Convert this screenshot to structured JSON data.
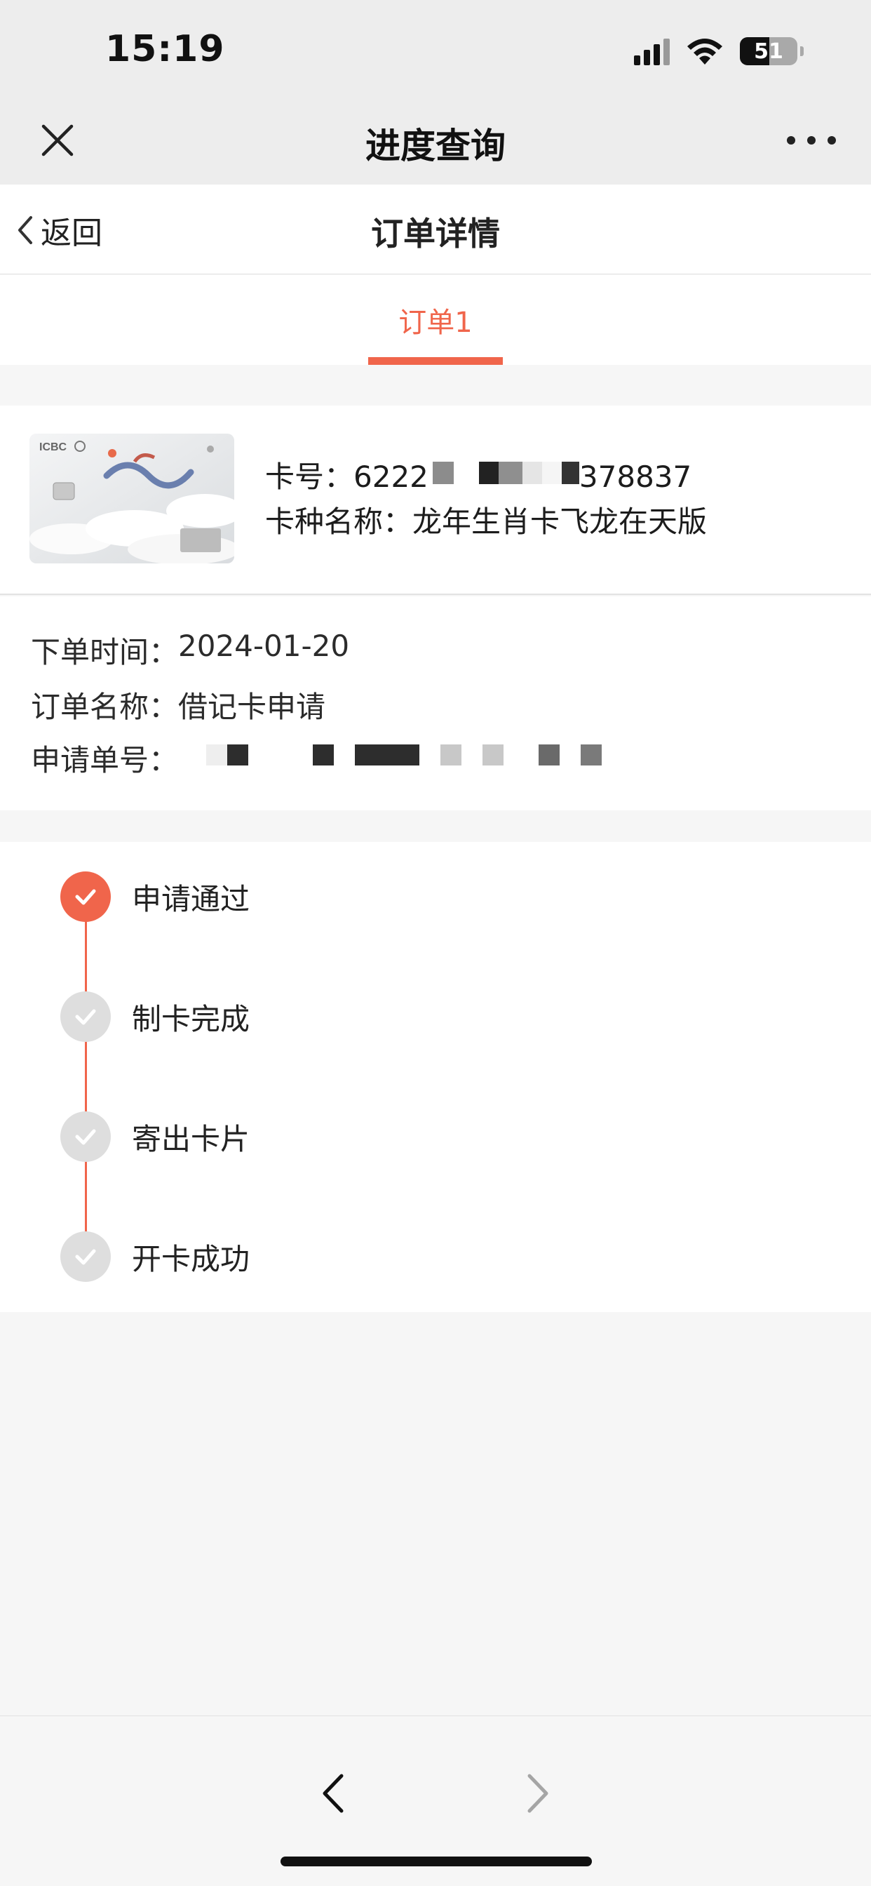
{
  "status_bar": {
    "time": "15:19",
    "battery": "51"
  },
  "wechat_bar": {
    "title": "进度查询",
    "close_icon": "close-icon",
    "more_icon": "more-icon"
  },
  "header": {
    "back_label": "返回",
    "title": "订单详情"
  },
  "tabs": [
    {
      "label": "订单1",
      "active": true
    }
  ],
  "card": {
    "number_label": "卡号：",
    "number_prefix": "6222",
    "number_suffix": "378837",
    "type_label": "卡种名称：",
    "type_value": "龙年生肖卡飞龙在天版"
  },
  "order": {
    "time_label": "下单时间：",
    "time_value": "2024-01-20",
    "name_label": "订单名称：",
    "name_value": "借记卡申请",
    "no_label": "申请单号："
  },
  "steps": [
    {
      "label": "申请通过",
      "done": true
    },
    {
      "label": "制卡完成",
      "done": false
    },
    {
      "label": "寄出卡片",
      "done": false
    },
    {
      "label": "开卡成功",
      "done": false
    }
  ],
  "colors": {
    "accent": "#f0654b",
    "pending": "#dedede",
    "page_bg": "#f6f6f6"
  }
}
